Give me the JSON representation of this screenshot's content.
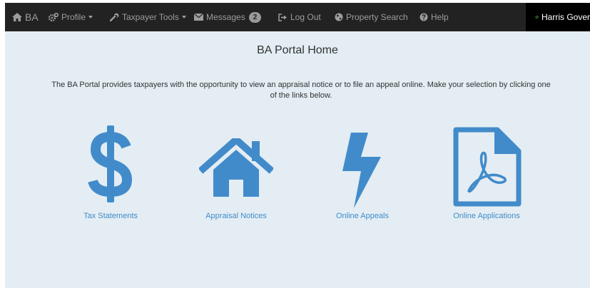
{
  "navbar": {
    "brand": "BA",
    "items": [
      {
        "label": "Profile",
        "icon": "cogs-icon",
        "dropdown": true
      },
      {
        "label": "Taxpayer Tools",
        "icon": "wrench-icon",
        "dropdown": true
      },
      {
        "label": "Messages",
        "icon": "envelope-icon",
        "badge": "2"
      },
      {
        "label": "Log Out",
        "icon": "sign-out-icon"
      },
      {
        "label": "Property Search",
        "icon": "globe-icon"
      },
      {
        "label": "Help",
        "icon": "question-circle-icon"
      }
    ],
    "user": "Harris Gover"
  },
  "main": {
    "title": "BA Portal Home",
    "intro": "The BA Portal provides taxpayers with the opportunity to view an appraisal notice or to file an appeal online. Make your selection by clicking one of the links below.",
    "tiles": [
      {
        "label": "Tax Statements",
        "icon": "dollar-icon"
      },
      {
        "label": "Appraisal Notices",
        "icon": "home-icon"
      },
      {
        "label": "Online Appeals",
        "icon": "bolt-icon"
      },
      {
        "label": "Online Applications",
        "icon": "file-pdf-icon"
      }
    ]
  },
  "colors": {
    "navbar_bg": "#222222",
    "nav_text": "#9d9d9d",
    "page_bg": "#e3edf3",
    "icon_blue": "#428bca",
    "link_blue": "#428bca"
  }
}
